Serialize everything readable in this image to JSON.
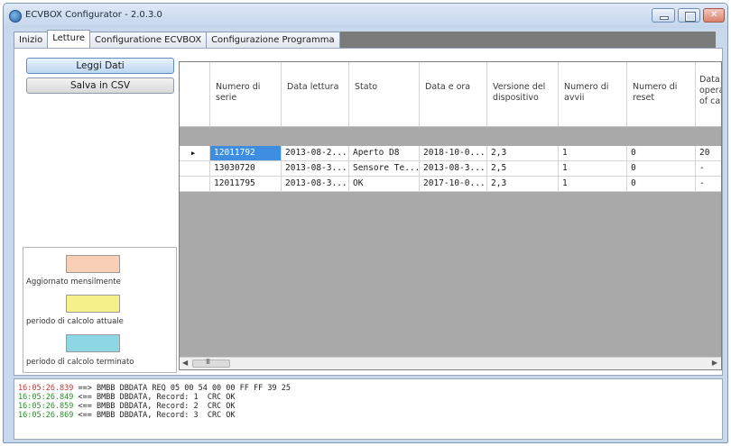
{
  "window": {
    "title": "ECVBOX Configurator - 2.0.3.0"
  },
  "tabs": [
    "Inizio",
    "Letture",
    "Configuratione ECVBOX",
    "Configurazione Programma"
  ],
  "actions": {
    "read_label": "Leggi Dati",
    "csv_label": "Salva in CSV"
  },
  "legend": [
    {
      "label": "Aggiornato mensilmente",
      "color": "#f9d0b6"
    },
    {
      "label": "periodo di calcolo attuale",
      "color": "#f6f08a"
    },
    {
      "label": "periodo di calcolo terminato",
      "color": "#8fd6e4"
    }
  ],
  "table": {
    "columns": [
      "Numero di serie",
      "Data lettura",
      "Stato",
      "Data e ora",
      "Versione del dispositivo",
      "Numero di avvii",
      "Numero di reset",
      "Data operazione of ca"
    ],
    "rows": [
      [
        "12011792",
        "2013-08-2...",
        "Aperto D8",
        "2018-10-0...",
        "2,3",
        "1",
        "0",
        "20"
      ],
      [
        "13030720",
        "2013-08-3...",
        "Sensore Te...",
        "2013-08-3...",
        "2,5",
        "1",
        "0",
        "-"
      ],
      [
        "12011795",
        "2013-08-3...",
        "OK",
        "2017-10-0...",
        "2,3",
        "1",
        "0",
        "-"
      ]
    ],
    "scroll_thumb": "III"
  },
  "log": [
    {
      "ts": "16:05:26.839",
      "msg": " ==> BMBB DBDATA REQ 05 00 54 00 00 FF FF 39 25"
    },
    {
      "ts": "16:05:26.849",
      "msg": " <== BMBB DBDATA, Record: 1  CRC OK"
    },
    {
      "ts": "16:05:26.859",
      "msg": " <== BMBB DBDATA, Record: 2  CRC OK"
    },
    {
      "ts": "16:05:26.869",
      "msg": " <== BMBB DBDATA, Record: 3  CRC OK"
    }
  ]
}
